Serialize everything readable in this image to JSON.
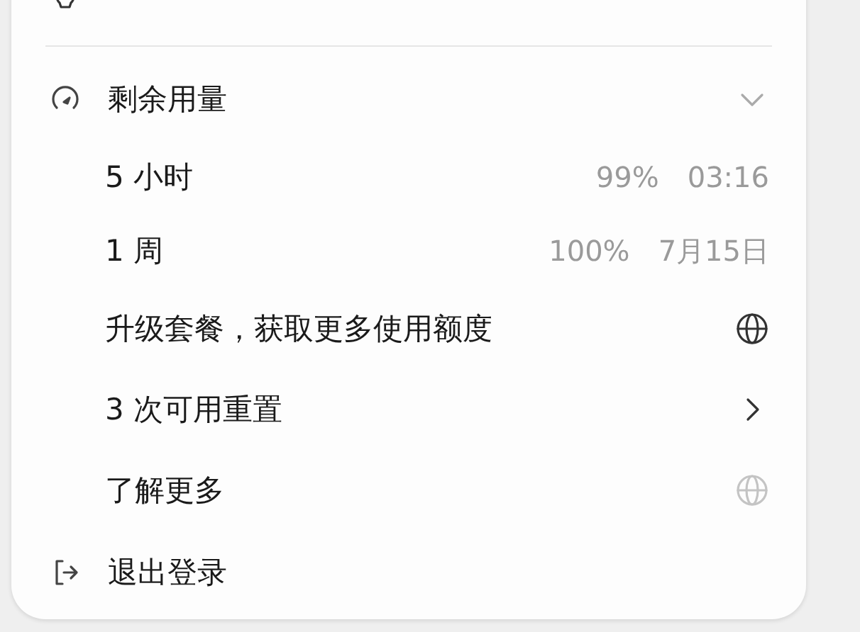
{
  "usage_section": {
    "title": "剩余用量",
    "expanded": true
  },
  "items": [
    {
      "kind": "usage",
      "label": "5 小时",
      "percent": "99%",
      "reset": "03:16"
    },
    {
      "kind": "usage",
      "label": "1 周",
      "percent": "100%",
      "reset": "7月15日"
    },
    {
      "kind": "link",
      "label": "升级套餐，获取更多使用额度",
      "faded": false
    },
    {
      "kind": "submenu",
      "label": "3 次可用重置"
    },
    {
      "kind": "link",
      "label": "了解更多",
      "faded": true
    }
  ],
  "logout": {
    "label": "退出登录"
  }
}
